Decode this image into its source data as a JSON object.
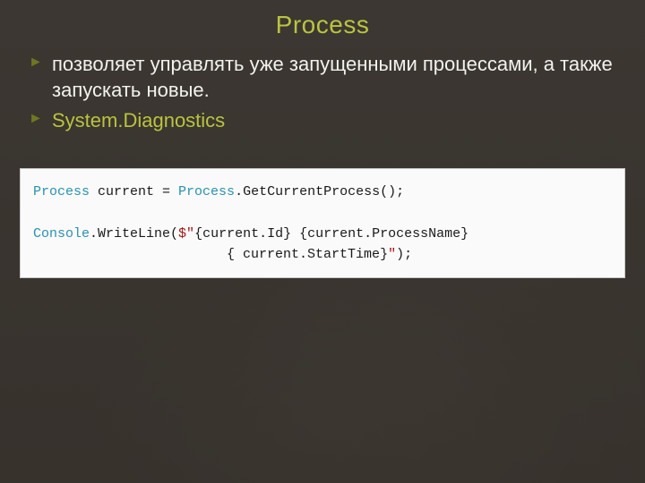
{
  "title": "Process",
  "bullets": [
    {
      "text": "позволяет управлять уже запущенными процессами, а также запускать новые.",
      "style": "white"
    },
    {
      "text": "System.Diagnostics",
      "style": "olive"
    }
  ],
  "code": {
    "t1": "Process",
    "t2": " current = ",
    "t3": "Process",
    "t4": ".GetCurrentProcess();",
    "blank": "",
    "t5": "Console",
    "t6": ".WriteLine(",
    "t7": "$\"",
    "t8": "{current.Id} {current.ProcessName}",
    "t9": "                        { current.StartTime}",
    "t10": "\"",
    "t11": ");"
  }
}
